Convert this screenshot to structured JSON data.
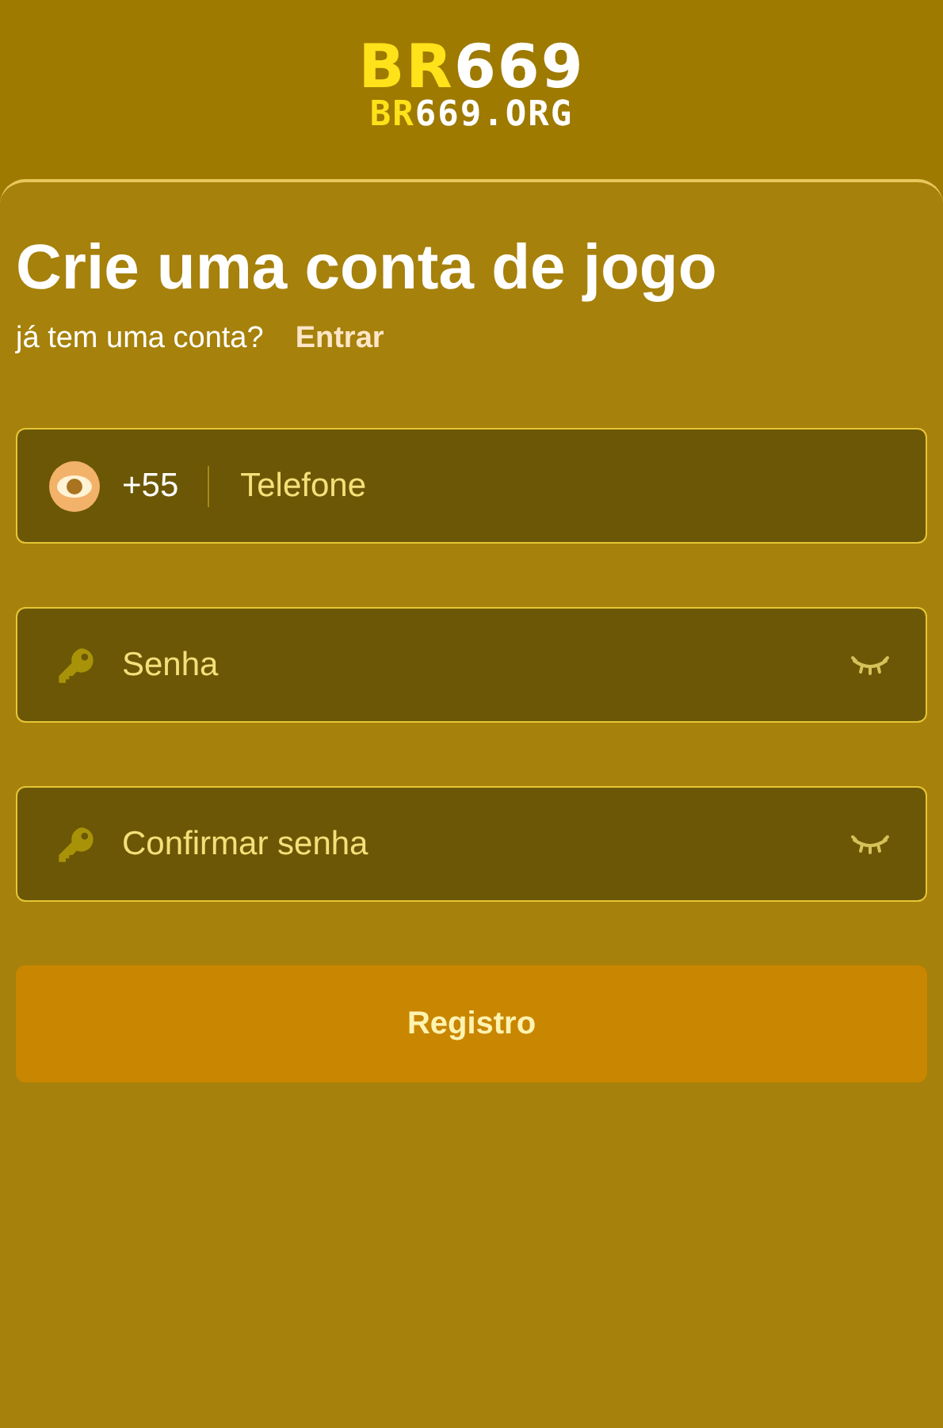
{
  "logo": {
    "accent": "BR",
    "rest": "669"
  },
  "logo_domain": {
    "accent": "BR",
    "rest": "669.ORG"
  },
  "title": "Crie uma conta de jogo",
  "login_prompt": {
    "text": "já tem uma conta?",
    "link": "Entrar"
  },
  "fields": [
    {
      "kind": "phone",
      "prefix": "+55",
      "placeholder": "Telefone"
    },
    {
      "kind": "password",
      "placeholder": "Senha"
    },
    {
      "kind": "password",
      "placeholder": "Confirmar senha"
    }
  ],
  "submit": {
    "label": "Registro",
    "disabled": true
  }
}
